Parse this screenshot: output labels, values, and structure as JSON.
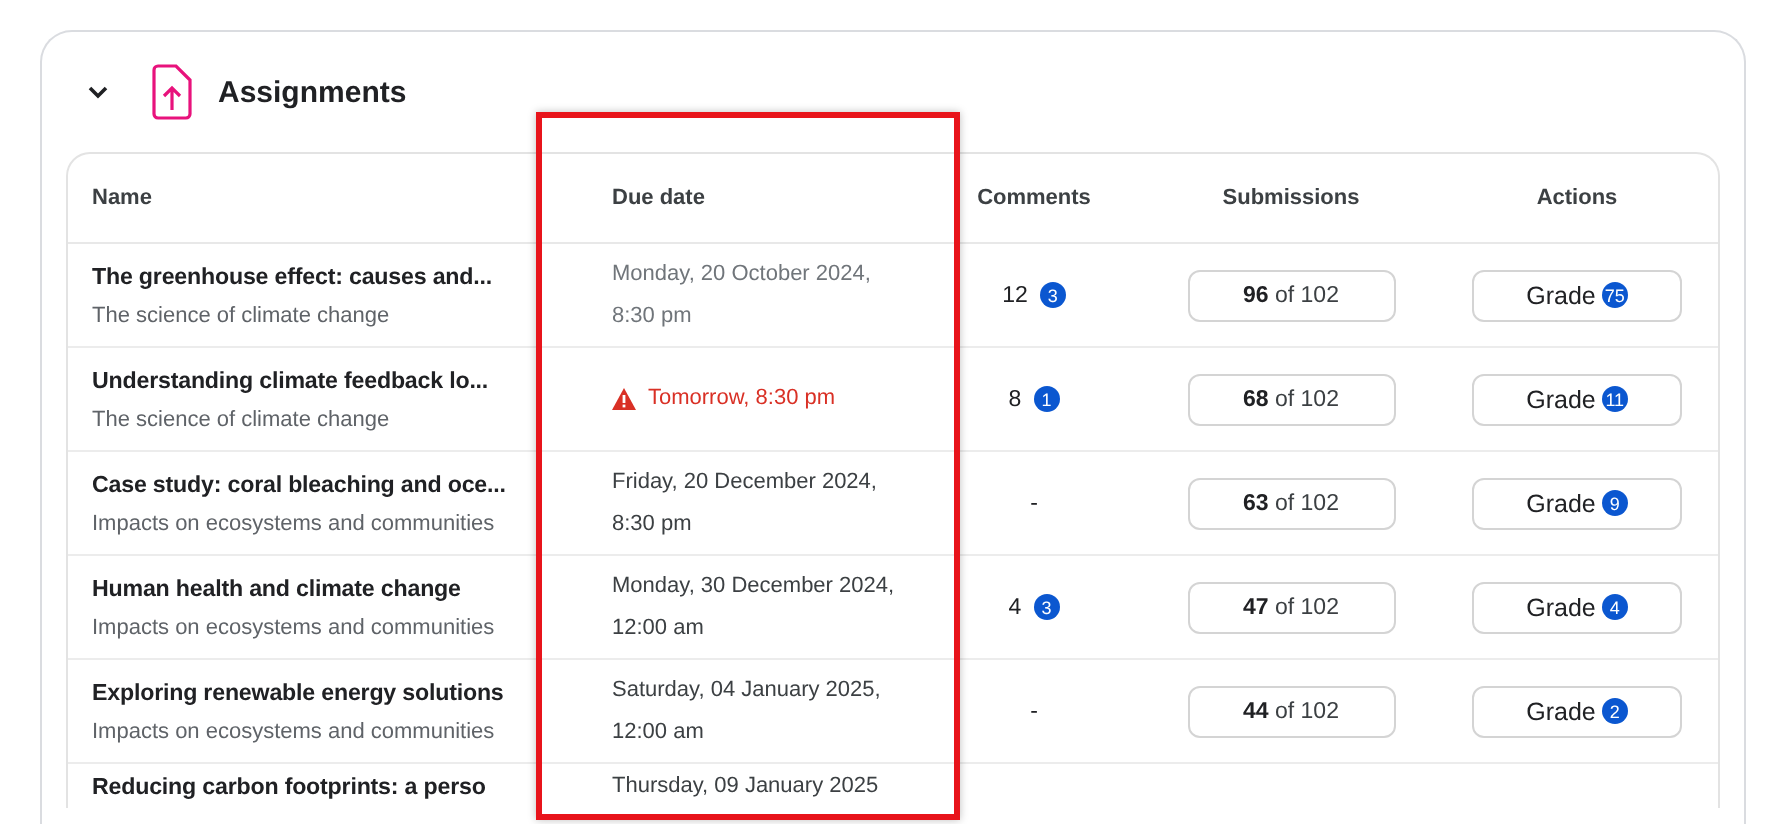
{
  "section": {
    "title": "Assignments",
    "expanded": true
  },
  "due_column_highlighted": true,
  "table": {
    "columns": [
      "Name",
      "Due date",
      "Comments",
      "Submissions",
      "Actions"
    ],
    "rows": [
      {
        "title": "The greenhouse effect: causes and...",
        "topic": "The science of climate change",
        "due": "Monday, 20 October 2024, 8:30 pm",
        "muted": true,
        "warning": false,
        "comments": "12",
        "new_comments": "3",
        "submitted": "96",
        "total": "of 102",
        "action": "Grade",
        "to_grade": "75"
      },
      {
        "title": "Understanding climate feedback lo...",
        "topic": "The science of climate change",
        "due": "Tomorrow, 8:30 pm",
        "muted": false,
        "warning": true,
        "comments": "8",
        "new_comments": "1",
        "submitted": "68",
        "total": "of 102",
        "action": "Grade",
        "to_grade": "11"
      },
      {
        "title": "Case study: coral bleaching and oce...",
        "topic": "Impacts on ecosystems and communities",
        "due": "Friday, 20 December 2024, 8:30 pm",
        "muted": false,
        "warning": false,
        "comments": "-",
        "submitted": "63",
        "total": "of 102",
        "action": "Grade",
        "to_grade": "9"
      },
      {
        "title": "Human health and climate change",
        "topic": "Impacts on ecosystems and communities",
        "due": "Monday, 30 December 2024, 12:00 am",
        "muted": false,
        "warning": false,
        "comments": "4",
        "new_comments": "3",
        "submitted": "47",
        "total": "of 102",
        "action": "Grade",
        "to_grade": "4"
      },
      {
        "title": "Exploring renewable energy solutions",
        "topic": "Impacts on ecosystems and communities",
        "due": "Saturday, 04 January 2025, 12:00 am",
        "muted": false,
        "warning": false,
        "comments": "-",
        "submitted": "44",
        "total": "of 102",
        "action": "Grade",
        "to_grade": "2"
      }
    ],
    "partial_row": {
      "title": "Reducing carbon footprints: a perso",
      "due": "Thursday, 09 January 2025"
    }
  }
}
